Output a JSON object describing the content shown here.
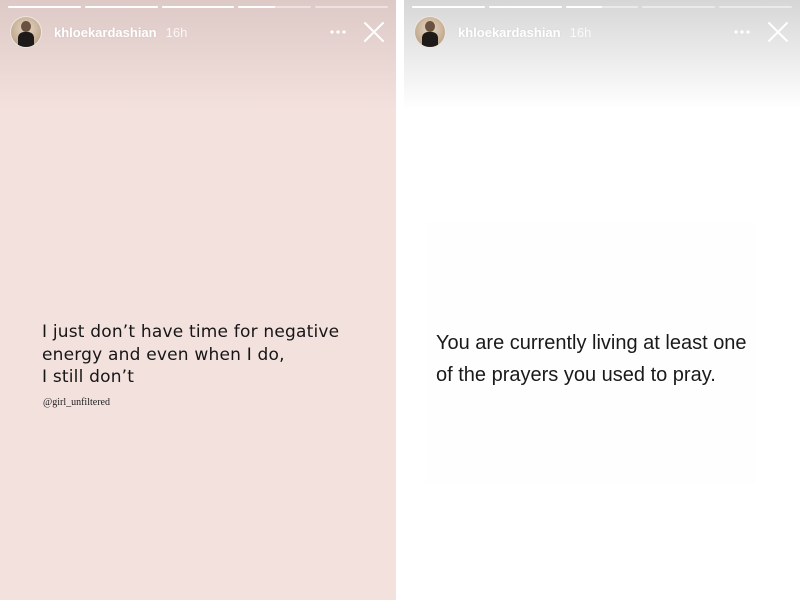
{
  "stories": [
    {
      "username": "khloekardashian",
      "time": "16h",
      "progress": [
        1,
        1,
        1,
        0.5,
        0
      ],
      "quote_lines": [
        "I just don’t have time for negative",
        "energy and even when I do,",
        "I still don’t"
      ],
      "credit": "@girl_unfiltered",
      "background": "#f3e1de"
    },
    {
      "username": "khloekardashian",
      "time": "16h",
      "progress": [
        1,
        1,
        0.5,
        0,
        0
      ],
      "quote_lines": [
        "You are currently living at least one",
        "of the prayers you used to pray."
      ],
      "background": "#ffffff"
    }
  ],
  "icons": {
    "more": "more-horizontal-icon",
    "close": "close-icon",
    "avatar": "profile-avatar"
  }
}
